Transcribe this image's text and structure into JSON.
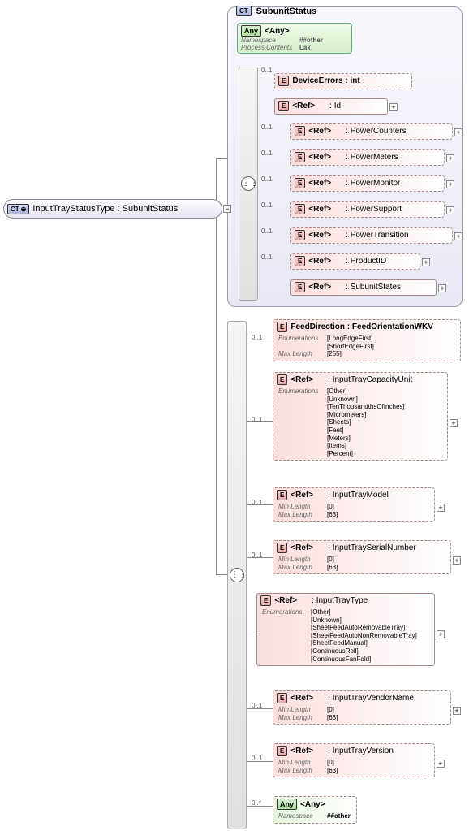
{
  "root": {
    "badge": "CT",
    "label": "InputTrayStatusType : SubunitStatus"
  },
  "subunit": {
    "badge": "CT",
    "label": "SubunitStatus",
    "any": {
      "badge": "Any",
      "label": "<Any>",
      "rows": [
        {
          "k": "Namespace",
          "v": "##other"
        },
        {
          "k": "Process Contents",
          "v": "Lax"
        }
      ]
    },
    "elements": [
      {
        "card": "0..1",
        "badge": "E",
        "name": "DeviceErrors : int",
        "dashed": true,
        "plus": false
      },
      {
        "card": "",
        "badge": "E",
        "name": "<Ref>",
        "suffix": ": Id",
        "dashed": false,
        "plus": true
      },
      {
        "card": "0..1",
        "badge": "E",
        "name": "<Ref>",
        "suffix": ": PowerCounters",
        "dashed": true,
        "plus": true
      },
      {
        "card": "0..1",
        "badge": "E",
        "name": "<Ref>",
        "suffix": ": PowerMeters",
        "dashed": true,
        "plus": true
      },
      {
        "card": "0..1",
        "badge": "E",
        "name": "<Ref>",
        "suffix": ": PowerMonitor",
        "dashed": true,
        "plus": true
      },
      {
        "card": "0..1",
        "badge": "E",
        "name": "<Ref>",
        "suffix": ": PowerSupport",
        "dashed": true,
        "plus": true
      },
      {
        "card": "0..1",
        "badge": "E",
        "name": "<Ref>",
        "suffix": ": PowerTransition",
        "dashed": true,
        "plus": true
      },
      {
        "card": "0..1",
        "badge": "E",
        "name": "<Ref>",
        "suffix": ": ProductID",
        "dashed": true,
        "plus": true
      },
      {
        "card": "",
        "badge": "E",
        "name": "<Ref>",
        "suffix": ": SubunitStates",
        "dashed": false,
        "plus": true
      }
    ]
  },
  "ext": [
    {
      "card": "0..1",
      "badge": "E",
      "name": "FeedDirection : FeedOrientationWKV",
      "dashed": true,
      "plus": true,
      "details": [
        {
          "k": "Enumerations",
          "v": [
            "[LongEdgeFirst]",
            "[ShortEdgeFirst]"
          ]
        },
        {
          "k": "Max Length",
          "v": [
            "[255]"
          ]
        }
      ]
    },
    {
      "card": "0..1",
      "badge": "E",
      "name": "<Ref>",
      "suffix": ": InputTrayCapacityUnit",
      "dashed": true,
      "plus": true,
      "details": [
        {
          "k": "Enumerations",
          "v": [
            "[Other]",
            "[Unknown]",
            "[TenThousandthsOfInches]",
            "[Micrometers]",
            "[Sheets]",
            "[Feet]",
            "[Meters]",
            "[Items]",
            "[Percent]"
          ]
        }
      ]
    },
    {
      "card": "0..1",
      "badge": "E",
      "name": "<Ref>",
      "suffix": ": InputTrayModel",
      "dashed": true,
      "plus": true,
      "details": [
        {
          "k": "Min Length",
          "v": [
            "[0]"
          ]
        },
        {
          "k": "Max Length",
          "v": [
            "[63]"
          ]
        }
      ]
    },
    {
      "card": "0..1",
      "badge": "E",
      "name": "<Ref>",
      "suffix": ": InputTraySerialNumber",
      "dashed": true,
      "plus": true,
      "details": [
        {
          "k": "Min Length",
          "v": [
            "[0]"
          ]
        },
        {
          "k": "Max Length",
          "v": [
            "[63]"
          ]
        }
      ]
    },
    {
      "card": "",
      "badge": "E",
      "name": "<Ref>",
      "suffix": ": InputTrayType",
      "dashed": false,
      "plus": true,
      "details": [
        {
          "k": "Enumerations",
          "v": [
            "[Other]",
            "[Unknown]",
            "[SheetFeedAutoRemovableTray]",
            "[SheetFeedAutoNonRemovableTray]",
            "[SheetFeedManual]",
            "[ContinuousRoll]",
            "[ContinuousFanFold]"
          ]
        }
      ]
    },
    {
      "card": "0..1",
      "badge": "E",
      "name": "<Ref>",
      "suffix": ": InputTrayVendorName",
      "dashed": true,
      "plus": true,
      "details": [
        {
          "k": "Min Length",
          "v": [
            "[0]"
          ]
        },
        {
          "k": "Max Length",
          "v": [
            "[63]"
          ]
        }
      ]
    },
    {
      "card": "0..1",
      "badge": "E",
      "name": "<Ref>",
      "suffix": ": InputTrayVersion",
      "dashed": true,
      "plus": true,
      "details": [
        {
          "k": "Min Length",
          "v": [
            "[0]"
          ]
        },
        {
          "k": "Max Length",
          "v": [
            "[63]"
          ]
        }
      ]
    },
    {
      "card": "0..*",
      "badge": "Any",
      "name": "<Any>",
      "dashed": true,
      "plus": false,
      "isAny": true,
      "details": [
        {
          "k": "Namespace",
          "v": [
            "##other"
          ]
        }
      ]
    }
  ]
}
